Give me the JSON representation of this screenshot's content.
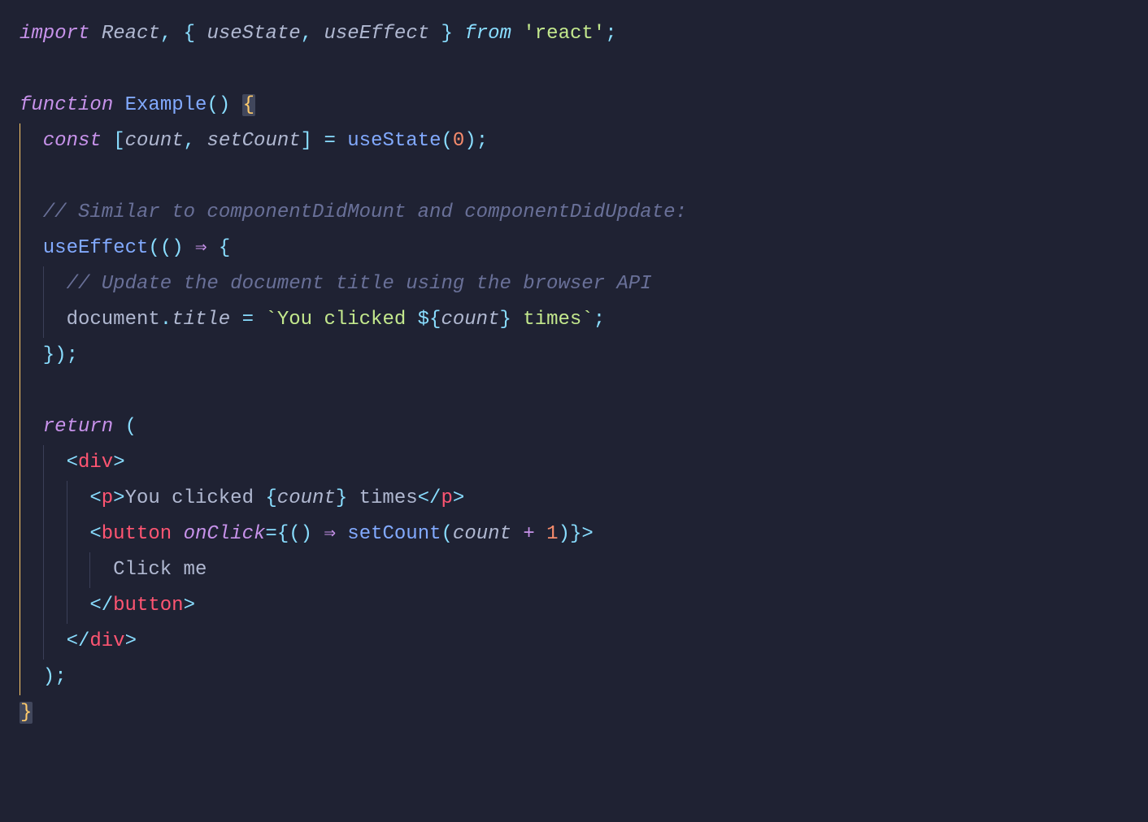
{
  "code": {
    "l1": {
      "import": "import",
      "react": "React",
      "comma": ",",
      "lbrace": "{",
      "useState": "useState",
      "comma2": ",",
      "useEffect": "useEffect",
      "rbrace": "}",
      "from": "from",
      "pkg": "'react'",
      "semi": ";"
    },
    "l3": {
      "function": "function",
      "name": "Example",
      "parens": "()",
      "lbrace": "{"
    },
    "l4": {
      "const": "const",
      "lbr": "[",
      "count": "count",
      "comma": ",",
      "setCount": "setCount",
      "rbr": "]",
      "eq": "=",
      "useState": "useState",
      "lpar": "(",
      "zero": "0",
      "rpar": ")",
      "semi": ";"
    },
    "l6": {
      "comment": "// Similar to componentDidMount and componentDidUpdate:"
    },
    "l7": {
      "useEffect": "useEffect",
      "lpar": "(",
      "lpar2": "(",
      "rpar2": ")",
      "arrow": "⇒",
      "lbrace": "{"
    },
    "l8": {
      "comment": "// Update the document title using the browser API"
    },
    "l9": {
      "doc": "document",
      "dot": ".",
      "title": "title",
      "eq": "=",
      "bt1": "`",
      "s1": "You clicked ",
      "dopen": "${",
      "count": "count",
      "dclose": "}",
      "s2": " times",
      "bt2": "`",
      "semi": ";"
    },
    "l10": {
      "rbrace": "}",
      "rpar": ")",
      "semi": ";"
    },
    "l12": {
      "return": "return",
      "lpar": "("
    },
    "l13": {
      "open": "<",
      "tag": "div",
      "close": ">"
    },
    "l14": {
      "open": "<",
      "tag": "p",
      "close": ">",
      "txt1": "You clicked ",
      "lb": "{",
      "count": "count",
      "rb": "}",
      "txt2": " times",
      "open2": "</",
      "tag2": "p",
      "close2": ">"
    },
    "l15": {
      "open": "<",
      "tag": "button",
      "attr": "onClick",
      "eq": "=",
      "lb": "{",
      "lpar": "(",
      "rpar": ")",
      "arrow": "⇒",
      "setCount": "setCount",
      "lpar2": "(",
      "count": "count",
      "plus": "+",
      "one": "1",
      "rpar2": ")",
      "rb": "}",
      "close": ">"
    },
    "l16": {
      "txt": "Click me"
    },
    "l17": {
      "open": "</",
      "tag": "button",
      "close": ">"
    },
    "l18": {
      "open": "</",
      "tag": "div",
      "close": ">"
    },
    "l19": {
      "rpar": ")",
      "semi": ";"
    },
    "l20": {
      "rbrace": "}"
    }
  }
}
